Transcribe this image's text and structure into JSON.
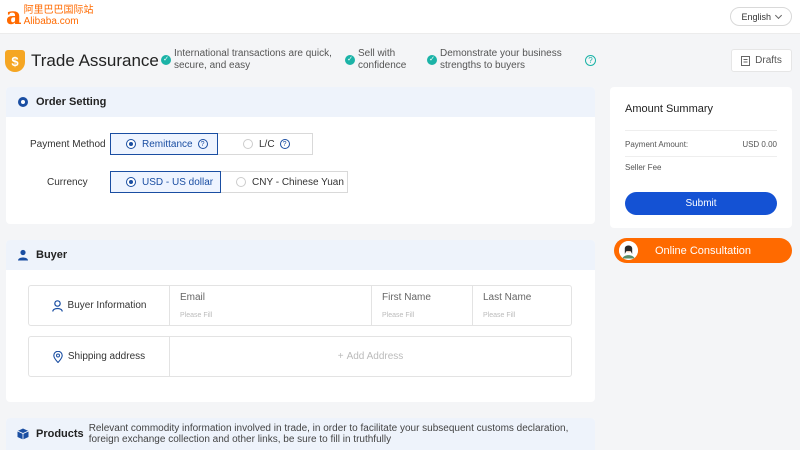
{
  "header": {
    "logo_mark": "a",
    "logo_cn": "阿里巴巴国际站",
    "logo_en": "Alibaba.com",
    "language": "English"
  },
  "trade_assurance": {
    "title": "Trade Assurance",
    "features": [
      {
        "line1": "International transactions are quick,",
        "line2": "secure, and easy"
      },
      {
        "line1": "Sell with",
        "line2": "confidence"
      },
      {
        "line1": "Demonstrate your business",
        "line2": "strengths to buyers"
      }
    ],
    "help_icon": "?"
  },
  "drafts": {
    "label": "Drafts"
  },
  "order_setting": {
    "title": "Order Setting",
    "payment_method": {
      "label": "Payment Method",
      "options": [
        {
          "label": "Remittance",
          "selected": true
        },
        {
          "label": "L/C",
          "selected": false
        }
      ]
    },
    "currency": {
      "label": "Currency",
      "options": [
        {
          "label": "USD - US dollar",
          "selected": true
        },
        {
          "label": "CNY - Chinese Yuan",
          "selected": false
        }
      ]
    }
  },
  "buyer": {
    "title": "Buyer",
    "info_label": "Buyer Information",
    "fields": [
      {
        "label": "Email",
        "placeholder": "Please Fill"
      },
      {
        "label": "First Name",
        "placeholder": "Please Fill"
      },
      {
        "label": "Last Name",
        "placeholder": "Please Fill"
      }
    ],
    "shipping_label": "Shipping address",
    "add_address": "Add Address"
  },
  "products": {
    "title": "Products",
    "description": "Relevant commodity information involved in trade, in order to facilitate your subsequent customs declaration, foreign exchange collection and other links, be sure to fill in truthfully"
  },
  "amount_summary": {
    "title": "Amount Summary",
    "payment_amount_label": "Payment Amount:",
    "payment_amount_value": "USD 0.00",
    "seller_fee_label": "Seller Fee",
    "submit_label": "Submit"
  },
  "consultation": {
    "label": "Online Consultation"
  },
  "colors": {
    "brand_orange": "#ff6a00",
    "primary_blue": "#1452d4",
    "teal": "#1bb3a7"
  }
}
